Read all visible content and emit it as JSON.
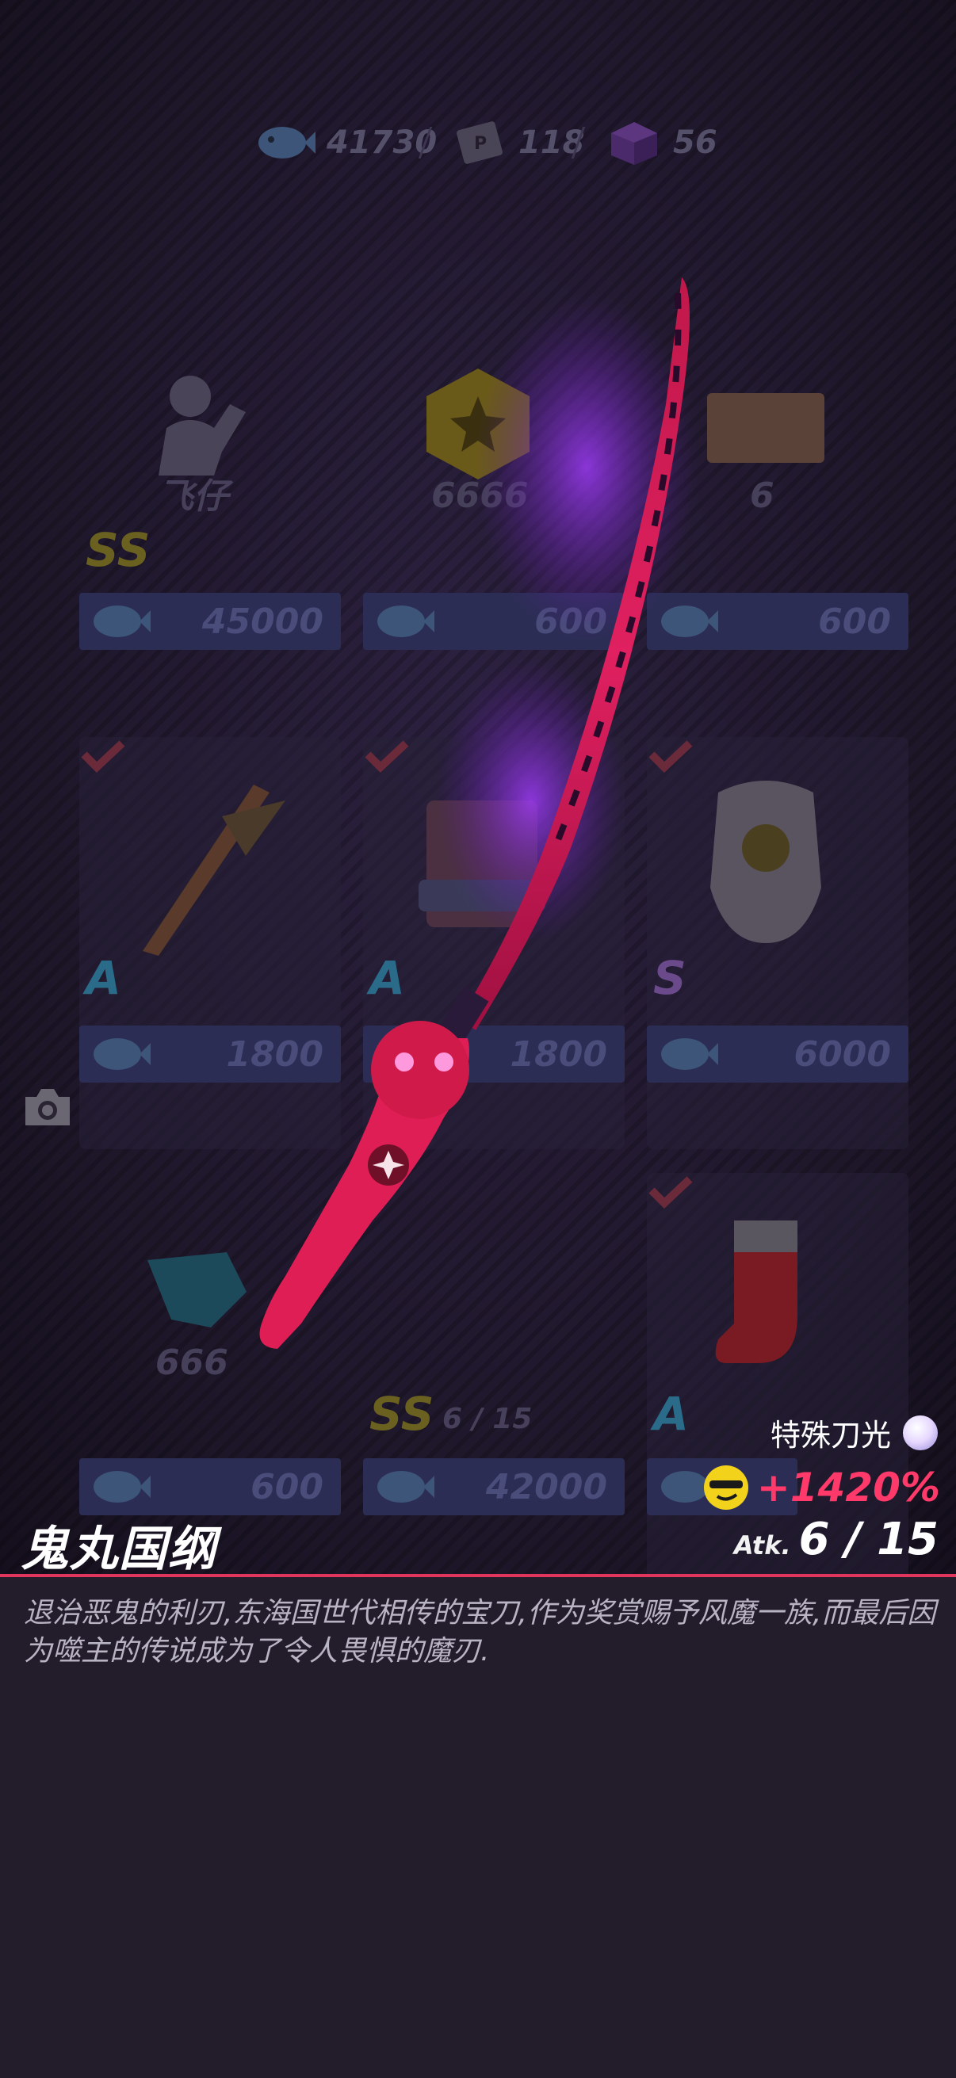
{
  "currencies": [
    {
      "icon": "fish-coin-icon",
      "value": "41730"
    },
    {
      "icon": "ticket-icon",
      "value": "118"
    },
    {
      "icon": "purple-cube-icon",
      "value": "56"
    }
  ],
  "cards": [
    {
      "label": "飞仔",
      "rank": "SS",
      "price": "45000"
    },
    {
      "label": "6666",
      "rank": "",
      "price": "600"
    },
    {
      "label": "6",
      "rank": "",
      "price": "600"
    },
    {
      "label": "",
      "rank": "A",
      "price": "1800"
    },
    {
      "label": "",
      "rank": "A",
      "price": "1800"
    },
    {
      "label": "",
      "rank": "S",
      "price": "6000"
    },
    {
      "label": "666",
      "rank": "",
      "price": "600"
    },
    {
      "label": "6 / 15",
      "rank": "SS",
      "price": "42000"
    },
    {
      "label": "",
      "rank": "A",
      "price": ""
    }
  ],
  "weapon": {
    "name": "鬼丸国纲",
    "special": "特殊刀光",
    "bonus": "+1420%",
    "atk_label": "Atk.",
    "atk_value": "6 / 15",
    "description": "退治恶鬼的利刃,东海国世代相传的宝刀,作为奖赏赐予风魔一族,而最后因为噬主的传说成为了令人畏惧的魔刃."
  },
  "colors": {
    "accent_red": "#e2355e",
    "bonus_pink": "#ff3a6a",
    "rank_ss": "#6a6020",
    "rank_a": "#2a6b8a",
    "rank_s": "#6a4a8a"
  }
}
